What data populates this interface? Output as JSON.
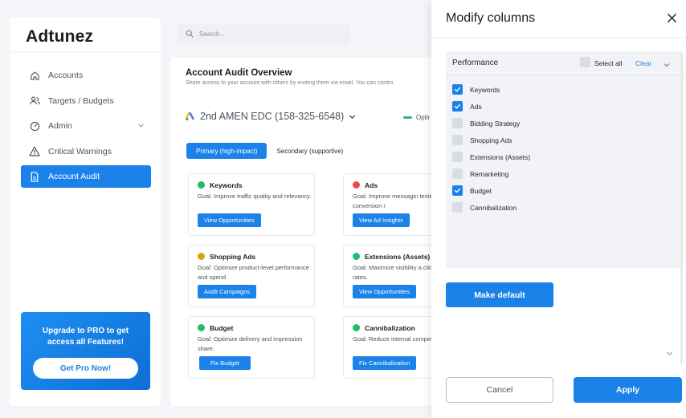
{
  "app": {
    "logo": "Adtunez"
  },
  "search": {
    "placeholder": "Search..."
  },
  "sidebar": {
    "items": [
      {
        "label": "Accounts",
        "icon": "home-icon"
      },
      {
        "label": "Targets / Budgets",
        "icon": "users-icon"
      },
      {
        "label": "Admin",
        "icon": "gauge-icon"
      },
      {
        "label": "Critical Warnings",
        "icon": "warning-icon"
      },
      {
        "label": "Account Audit",
        "icon": "document-icon",
        "active": true
      }
    ],
    "promo": {
      "text": "Upgrade to  PRO to get access all Features!",
      "button": "Get Pro Now!"
    }
  },
  "main": {
    "title": "Account Audit Overview",
    "subtitle": "Share access to your account with others by inviting them via email. You can contro",
    "account": "2nd AMEN EDC (158-325-6548)",
    "status": "Optir",
    "tabs": [
      "Primary (high-impact)",
      "Secondary (supportive)"
    ],
    "cards": [
      {
        "title": "Keywords",
        "goal": "Goal: Improve traffic quality and relevancy.",
        "button": "View Opportunities",
        "color": "#1dbf6e"
      },
      {
        "title": "Ads",
        "goal": "Goal: Improve messagin testing, and conversion r",
        "button": "View Ad Insights",
        "color": "#ea4a4a"
      },
      {
        "title": "Shopping Ads",
        "goal": "Goal: Optimize product-level performance and spend.",
        "button": "Audit Campaigns",
        "color": "#d9a20f"
      },
      {
        "title": "Extensions (Assets)",
        "goal": "Goal: Maximize visibility a click-through rates.",
        "button": "View Opportunities",
        "color": "#1dbf6e"
      },
      {
        "title": "Budget",
        "goal": "Goal: Optimize delivery and impression share.",
        "button": "Fix Budget",
        "color": "#1dbf6e"
      },
      {
        "title": "Cannibalization",
        "goal": "Goal: Reduce internal competition.",
        "button": "Fix Cannibalization",
        "color": "#1dbf6e"
      }
    ]
  },
  "panel": {
    "title": "Modify columns",
    "category": "Performance",
    "select_all": "Select all",
    "clear": "Clear",
    "options": [
      {
        "label": "Keywords",
        "checked": true
      },
      {
        "label": "Ads",
        "checked": true
      },
      {
        "label": "Bidding Strategy",
        "checked": false
      },
      {
        "label": "Shopping Ads",
        "checked": false
      },
      {
        "label": "Extensions (Assets)",
        "checked": false
      },
      {
        "label": "Remarketing",
        "checked": false
      },
      {
        "label": "Budget",
        "checked": true
      },
      {
        "label": "Cannibalization",
        "checked": false
      }
    ],
    "make_default": "Make default",
    "cancel": "Cancel",
    "apply": "Apply"
  },
  "colors": {
    "accent": "#1a82e8",
    "success": "#1dbf6e",
    "danger": "#ea4a4a",
    "warning": "#d9a20f"
  }
}
